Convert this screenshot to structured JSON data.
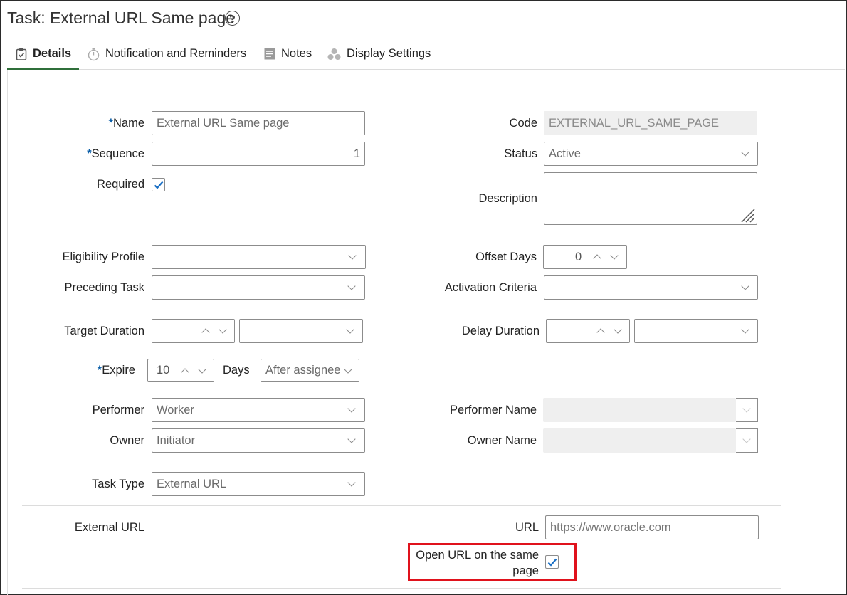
{
  "header": {
    "title": "Task: External URL Same page",
    "help_icon": "help-icon"
  },
  "tabs": [
    {
      "label": "Details",
      "icon": "clipboard-check-icon",
      "active": true
    },
    {
      "label": "Notification and Reminders",
      "icon": "stopwatch-icon",
      "active": false
    },
    {
      "label": "Notes",
      "icon": "note-icon",
      "active": false
    },
    {
      "label": "Display Settings",
      "icon": "display-settings-icon",
      "active": false
    }
  ],
  "form": {
    "name": {
      "label": "Name",
      "required_mark": "*",
      "value": "External URL Same page"
    },
    "sequence": {
      "label": "Sequence",
      "required_mark": "*",
      "value": "1"
    },
    "required": {
      "label": "Required",
      "checked": true
    },
    "code": {
      "label": "Code",
      "value": "EXTERNAL_URL_SAME_PAGE"
    },
    "status": {
      "label": "Status",
      "value": "Active"
    },
    "description": {
      "label": "Description",
      "value": ""
    },
    "eligibility_profile": {
      "label": "Eligibility Profile",
      "value": ""
    },
    "preceding_task": {
      "label": "Preceding Task",
      "value": ""
    },
    "offset_days": {
      "label": "Offset Days",
      "value": "0"
    },
    "activation_criteria": {
      "label": "Activation Criteria",
      "value": ""
    },
    "target_duration": {
      "label": "Target Duration",
      "value": "",
      "unit": ""
    },
    "delay_duration": {
      "label": "Delay Duration",
      "value": "",
      "unit": ""
    },
    "expire": {
      "label": "Expire",
      "required_mark": "*",
      "value": "10",
      "days_label": "Days",
      "after": "After assignee"
    },
    "performer": {
      "label": "Performer",
      "value": "Worker"
    },
    "owner": {
      "label": "Owner",
      "value": "Initiator"
    },
    "performer_name": {
      "label": "Performer Name",
      "value": ""
    },
    "owner_name": {
      "label": "Owner Name",
      "value": ""
    },
    "task_type": {
      "label": "Task Type",
      "value": "External URL"
    }
  },
  "external_url_section": {
    "heading": "External URL",
    "url": {
      "label": "URL",
      "placeholder": "https://www.oracle.com"
    },
    "open_same_page": {
      "label_line1": "Open URL on the same",
      "label_line2": "page",
      "checked": true
    }
  },
  "colors": {
    "required_mark": "#0c5fa8",
    "active_tab_underline": "#2f6f3a",
    "highlight_box": "#e0121c",
    "checkmark": "#1a6fc4"
  }
}
